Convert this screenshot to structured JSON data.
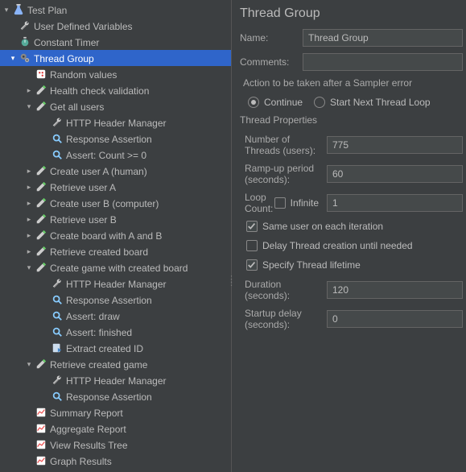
{
  "tree": {
    "test_plan": "Test Plan",
    "user_defined_vars": "User Defined Variables",
    "constant_timer": "Constant Timer",
    "thread_group": "Thread Group",
    "random_values": "Random values",
    "health_check": "Health check validation",
    "get_all_users": "Get all users",
    "http_header_mgr": "HTTP Header Manager",
    "response_assert": "Response Assertion",
    "assert_count": "Assert: Count >= 0",
    "create_user_a": "Create user A (human)",
    "retrieve_user_a": "Retrieve user A",
    "create_user_b": "Create user B (computer)",
    "retrieve_user_b": "Retrieve user B",
    "create_board": "Create board with A and B",
    "retrieve_board": "Retrieve created board",
    "create_game": "Create game with created board",
    "assert_draw": "Assert: draw",
    "assert_finished": "Assert: finished",
    "extract_id": "Extract created ID",
    "retrieve_game": "Retrieve created game",
    "summary_report": "Summary Report",
    "aggregate_report": "Aggregate Report",
    "view_results_tree": "View Results Tree",
    "graph_results": "Graph Results"
  },
  "panel": {
    "title": "Thread Group",
    "name_label": "Name:",
    "name_value": "Thread Group",
    "comments_label": "Comments:",
    "comments_value": "",
    "action_label": "Action to be taken after a Sampler error",
    "continue": "Continue",
    "start_next": "Start Next Thread Loop",
    "thread_props": "Thread Properties",
    "num_threads_label": "Number of Threads (users):",
    "num_threads_value": "775",
    "rampup_label": "Ramp-up period (seconds):",
    "rampup_value": "60",
    "loop_label": "Loop Count:",
    "infinite": "Infinite",
    "loop_value": "1",
    "same_user": "Same user on each iteration",
    "delay_creation": "Delay Thread creation until needed",
    "specify_lifetime": "Specify Thread lifetime",
    "duration_label": "Duration (seconds):",
    "duration_value": "120",
    "startup_label": "Startup delay (seconds):",
    "startup_value": "0"
  }
}
